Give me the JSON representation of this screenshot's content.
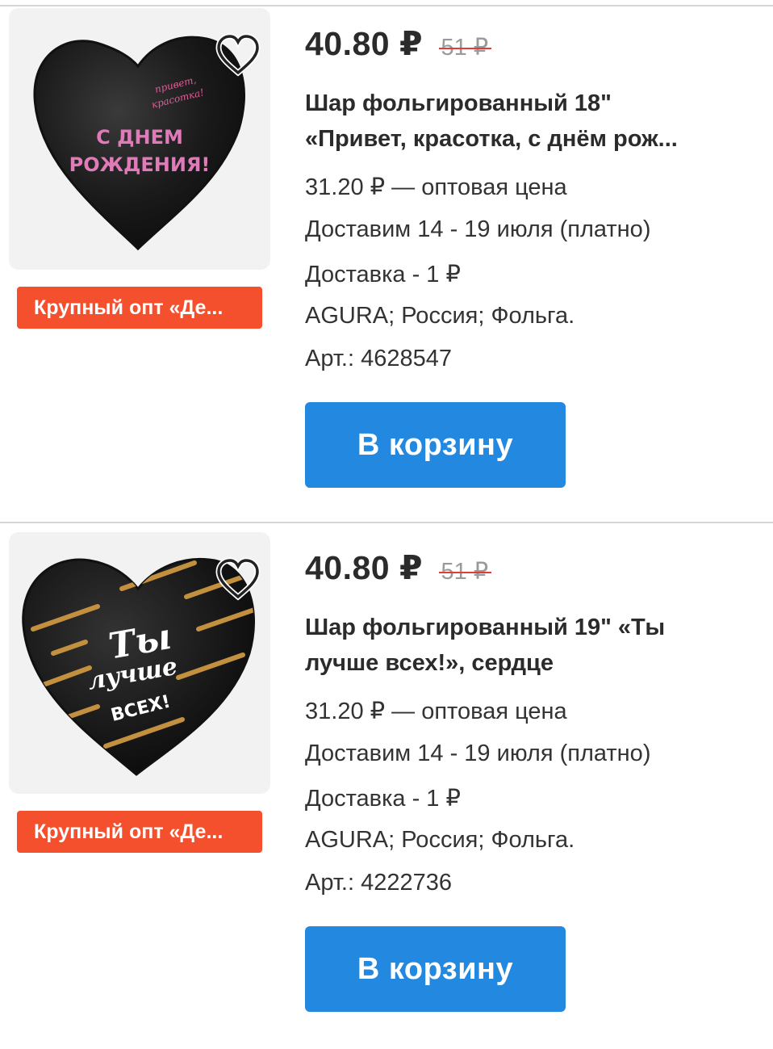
{
  "colors": {
    "accent": "#2388e0",
    "badge": "#f4502d",
    "strike": "#e23b3b"
  },
  "products": [
    {
      "price": "40.80 ₽",
      "old_price": "51 ₽",
      "title_line1": "Шар фольгированный 18\"",
      "title_line2": "«Привет, красотка, с днём рож...",
      "wholesale": "31.20 ₽ — оптовая цена",
      "delivery_date": "Доставим 14 - 19 июля (платно)",
      "delivery_cost": "Доставка - 1 ₽",
      "attributes": "AGURA; Россия; Фольга.",
      "article": "Арт.: 4628547",
      "badge": "Крупный опт «Де...",
      "cart_label": "В корзину",
      "favorite_icon": "heart-outline-icon",
      "image_text": {
        "small_1": "привет,",
        "small_2": "красотка!",
        "big_1": "С ДНЕМ",
        "big_2": "РОЖДЕНИЯ!"
      }
    },
    {
      "price": "40.80 ₽",
      "old_price": "51 ₽",
      "title_line1": "Шар фольгированный 19\" «Ты",
      "title_line2": "лучше всех!», сердце",
      "wholesale": "31.20 ₽ — оптовая цена",
      "delivery_date": "Доставим 14 - 19 июля (платно)",
      "delivery_cost": "Доставка - 1 ₽",
      "attributes": "AGURA; Россия; Фольга.",
      "article": "Арт.: 4222736",
      "badge": "Крупный опт «Де...",
      "cart_label": "В корзину",
      "favorite_icon": "heart-outline-icon",
      "image_text": {
        "big_1": "Ты",
        "big_2": "лучше",
        "big_3": "ВСЕХ!"
      }
    }
  ]
}
